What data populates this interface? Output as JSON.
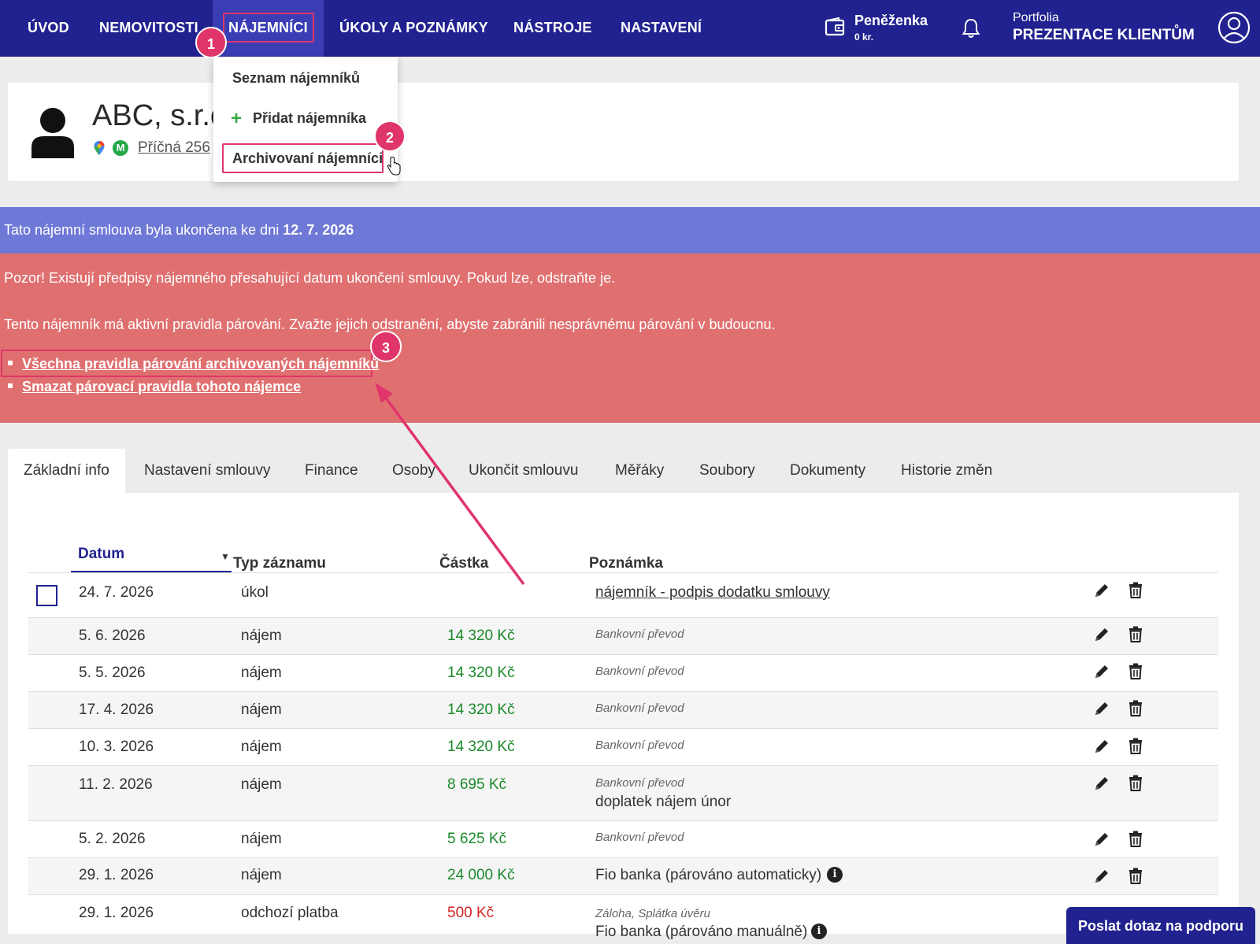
{
  "nav": {
    "items": [
      {
        "label": "ÚVOD"
      },
      {
        "label": "NEMOVITOSTI"
      },
      {
        "label": "NÁJEMNÍCI"
      },
      {
        "label": "ÚKOLY A POZNÁMKY"
      },
      {
        "label": "NÁSTROJE"
      },
      {
        "label": "NASTAVENÍ"
      }
    ],
    "active": "NÁJEMNÍCI",
    "wallet_title": "Peněženka",
    "wallet_amount": "0 kr.",
    "portfolio_label": "Portfolia",
    "portfolio_name": "PREZENTACE KLIENTŮM"
  },
  "dropdown": {
    "items": [
      "Seznam nájemníků",
      "Přidat nájemníka",
      "Archivovaní nájemníci"
    ],
    "highlighted": "Archivovaní nájemníci"
  },
  "tenant": {
    "name": "ABC, s.r.o.",
    "address": "Příčná 256"
  },
  "badges": [
    "1",
    "2",
    "3"
  ],
  "banner_blue": {
    "text": "Tato nájemní smlouva byla ukončena ke dni ",
    "date": "12. 7. 2026"
  },
  "banner_red": {
    "line1": "Pozor! Existují předpisy nájemného přesahující datum ukončení smlouvy. Pokud lze, odstraňte je.",
    "line2": "Tento nájemník má aktivní pravidla párování. Zvažte jejich odstranění, abyste zabránili nesprávnému párování v budoucnu.",
    "links": [
      "Všechna pravidla párování archivovaných nájemníků",
      "Smazat párovací pravidla tohoto nájemce"
    ]
  },
  "tabs": [
    "Základní info",
    "Nastavení smlouvy",
    "Finance",
    "Osoby",
    "Ukončit smlouvu",
    "Měřáky",
    "Soubory",
    "Dokumenty",
    "Historie změn"
  ],
  "active_tab": "Základní info",
  "table": {
    "headers": {
      "date": "Datum",
      "type": "Typ záznamu",
      "amount": "Částka",
      "note": "Poznámka"
    },
    "rows": [
      {
        "date": "24. 7. 2026",
        "type": "úkol",
        "amount": "",
        "note1": "",
        "note2": "nájemník - podpis dodatku smlouvy"
      },
      {
        "date": "5. 6. 2026",
        "type": "nájem",
        "amount": "14 320 Kč",
        "note1": "Bankovní převod",
        "note2": ""
      },
      {
        "date": "5. 5. 2026",
        "type": "nájem",
        "amount": "14 320 Kč",
        "note1": "Bankovní převod",
        "note2": ""
      },
      {
        "date": "17. 4. 2026",
        "type": "nájem",
        "amount": "14 320 Kč",
        "note1": "Bankovní převod",
        "note2": ""
      },
      {
        "date": "10. 3. 2026",
        "type": "nájem",
        "amount": "14 320 Kč",
        "note1": "Bankovní převod",
        "note2": ""
      },
      {
        "date": "11. 2. 2026",
        "type": "nájem",
        "amount": "8 695 Kč",
        "note1": "Bankovní převod",
        "note2": "doplatek nájem únor"
      },
      {
        "date": "5. 2. 2026",
        "type": "nájem",
        "amount": "5 625 Kč",
        "note1": "Bankovní převod",
        "note2": ""
      },
      {
        "date": "29. 1. 2026",
        "type": "nájem",
        "amount": "24 000 Kč",
        "note1": "",
        "note2": "Fio banka (párováno automaticky)"
      },
      {
        "date": "29. 1. 2026",
        "type": "odchozí platba",
        "amount": "500 Kč",
        "note1": "Záloha, Splátka úvěru",
        "note2": "Fio banka (párováno manuálně)"
      }
    ]
  },
  "support_button": "Poslat dotaz na podporu",
  "colors": {
    "nav_bg": "#21228f",
    "highlight": "#e0356a",
    "banner_blue": "#6e78d6",
    "banner_red": "#e07070",
    "amount_positive": "#1a8a2a",
    "amount_negative": "#d62424"
  },
  "icons": [
    "wallet-icon",
    "bell-icon",
    "user-icon",
    "avatar-icon",
    "map-pin-icon",
    "m-icon",
    "plus-icon",
    "pointer-cursor-icon",
    "edit-icon",
    "trash-icon",
    "info-icon",
    "sort-arrow-icon"
  ]
}
